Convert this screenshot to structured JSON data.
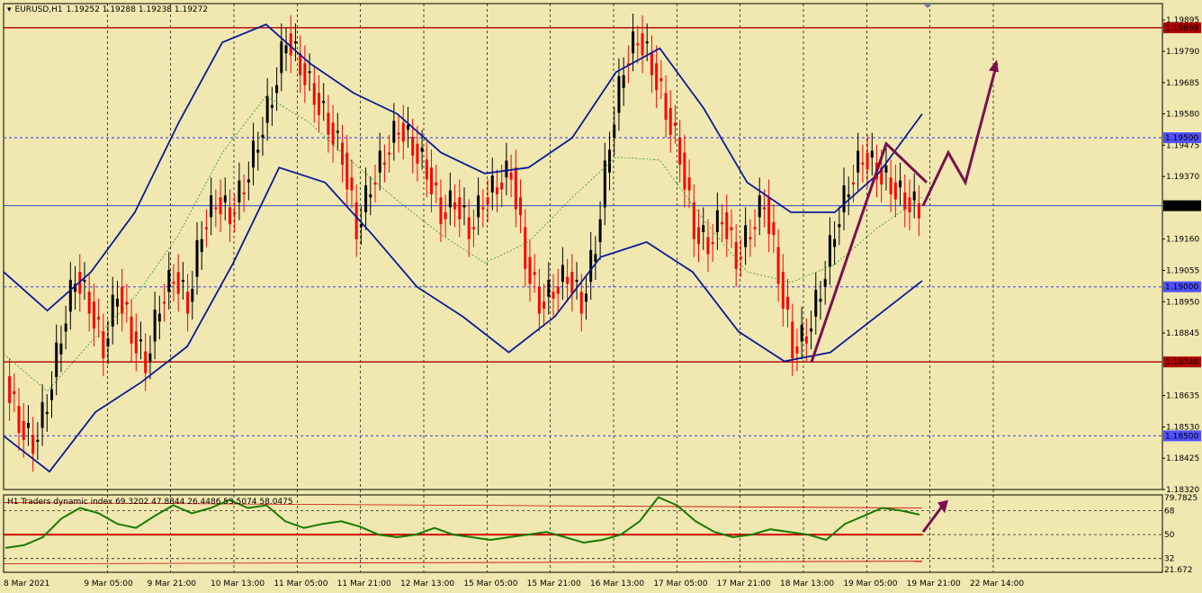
{
  "header": {
    "symbol": "EURUSD,H1",
    "ohlc": "1.19252 1.19288 1.19238 1.19272"
  },
  "indicator": {
    "label": "H1 Traders dynamic index 69.3202 47.8844 26.4486 53.5074 58.0475",
    "scale": [
      "79.7825",
      "68",
      "50",
      "32",
      "21.672"
    ]
  },
  "colors": {
    "background": "#f0e8b0",
    "bull_candle": "#000000",
    "bear_candle": "#ff0000",
    "bollinger": "#0a1a9a",
    "support_resistance": "#b00000",
    "arrows": "#7a1050",
    "tdi_line": "#1a7a00"
  },
  "chart_data": {
    "type": "line",
    "title": "EURUSD,H1",
    "price_axis": [
      "1.19895",
      "1.19790",
      "1.19685",
      "1.19580",
      "1.19475",
      "1.19370",
      "1.19160",
      "1.19055",
      "1.18950",
      "1.18845",
      "1.18635",
      "1.18530",
      "1.18425",
      "1.18320"
    ],
    "price_labels": [
      {
        "text": "1.19869",
        "kind": "resistance"
      },
      {
        "text": "1.19500",
        "kind": "level"
      },
      {
        "text": "1.19272",
        "kind": "current"
      },
      {
        "text": "1.19000",
        "kind": "level"
      },
      {
        "text": "1.18748",
        "kind": "support"
      },
      {
        "text": "1.18500",
        "kind": "level"
      }
    ],
    "time_axis": [
      "8 Mar 2021",
      "9 Mar 05:00",
      "9 Mar 21:00",
      "10 Mar 13:00",
      "11 Mar 05:00",
      "11 Mar 21:00",
      "12 Mar 13:00",
      "15 Mar 05:00",
      "15 Mar 21:00",
      "16 Mar 13:00",
      "17 Mar 05:00",
      "17 Mar 21:00",
      "18 Mar 13:00",
      "19 Mar 05:00",
      "19 Mar 21:00",
      "22 Mar 14:00"
    ],
    "ylim": [
      1.1832,
      1.1995
    ],
    "close_path": [
      1.187,
      1.1855,
      1.1848,
      1.1862,
      1.1885,
      1.1905,
      1.1895,
      1.188,
      1.19,
      1.1885,
      1.1875,
      1.1895,
      1.1905,
      1.1895,
      1.192,
      1.193,
      1.1925,
      1.1935,
      1.195,
      1.1965,
      1.1985,
      1.1975,
      1.1965,
      1.1955,
      1.1945,
      1.192,
      1.1935,
      1.1945,
      1.1955,
      1.1948,
      1.194,
      1.1925,
      1.193,
      1.192,
      1.193,
      1.1935,
      1.194,
      1.191,
      1.1895,
      1.19,
      1.1905,
      1.1895,
      1.1915,
      1.195,
      1.1975,
      1.1985,
      1.1975,
      1.196,
      1.1945,
      1.192,
      1.1915,
      1.1925,
      1.191,
      1.192,
      1.193,
      1.1905,
      1.188,
      1.1885,
      1.19,
      1.192,
      1.1935,
      1.1945,
      1.194,
      1.1935,
      1.193,
      1.1927
    ],
    "bb_upper": [
      1.1905,
      1.1892,
      1.1905,
      1.1925,
      1.1955,
      1.1982,
      1.1988,
      1.1975,
      1.1965,
      1.1958,
      1.1945,
      1.1938,
      1.194,
      1.195,
      1.1972,
      1.198,
      1.196,
      1.1935,
      1.1925,
      1.1925,
      1.1938,
      1.1958
    ],
    "bb_lower": [
      1.185,
      1.1838,
      1.1858,
      1.1868,
      1.188,
      1.1908,
      1.194,
      1.1935,
      1.1918,
      1.19,
      1.189,
      1.1878,
      1.189,
      1.191,
      1.1915,
      1.1905,
      1.1885,
      1.1875,
      1.1878,
      1.189,
      1.1902
    ],
    "resistance": 1.19869,
    "support": 1.18748,
    "current": 1.19272,
    "forecast_path": [
      1.19272,
      1.1945,
      1.1935,
      1.1975
    ],
    "tdi": [
      40,
      42,
      48,
      62,
      70,
      66,
      58,
      55,
      64,
      72,
      66,
      70,
      76,
      70,
      72,
      60,
      55,
      58,
      60,
      56,
      50,
      48,
      50,
      55,
      50,
      48,
      46,
      48,
      50,
      52,
      48,
      44,
      46,
      50,
      60,
      78,
      72,
      60,
      52,
      48,
      50,
      54,
      52,
      50,
      46,
      58,
      64,
      70,
      68,
      65
    ],
    "tdi_ylim": [
      21.672,
      79.7825
    ],
    "tdi_levels": [
      68,
      50,
      32
    ]
  }
}
